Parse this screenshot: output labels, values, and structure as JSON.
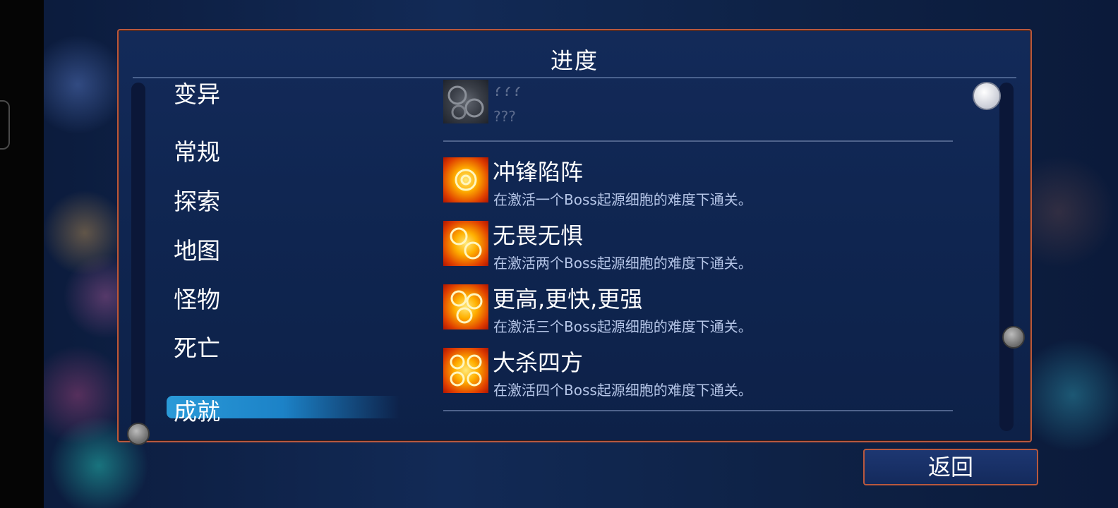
{
  "panel": {
    "title": "进度"
  },
  "nav": {
    "items": [
      {
        "label": "变异"
      },
      {
        "label": "常规"
      },
      {
        "label": "探索"
      },
      {
        "label": "地图"
      },
      {
        "label": "怪物"
      },
      {
        "label": "死亡"
      },
      {
        "label": "成就"
      }
    ],
    "selected": "成就"
  },
  "achievements": [
    {
      "title": "???",
      "desc": "???",
      "locked": true
    },
    {
      "title": "冲锋陷阵",
      "desc": "在激活一个Boss起源细胞的难度下通关。",
      "locked": false
    },
    {
      "title": "无畏无惧",
      "desc": "在激活两个Boss起源细胞的难度下通关。",
      "locked": false
    },
    {
      "title": "更高,更快,更强",
      "desc": "在激活三个Boss起源细胞的难度下通关。",
      "locked": false
    },
    {
      "title": "大杀四方",
      "desc": "在激活四个Boss起源细胞的难度下通关。",
      "locked": false
    }
  ],
  "footer": {
    "back_label": "返回"
  },
  "colors": {
    "frame_border": "#b8583e",
    "selected_highlight": "#2a9ad8",
    "panel_bg": "#132a59"
  },
  "icons": {
    "achievement": "boss-cell-icon"
  }
}
